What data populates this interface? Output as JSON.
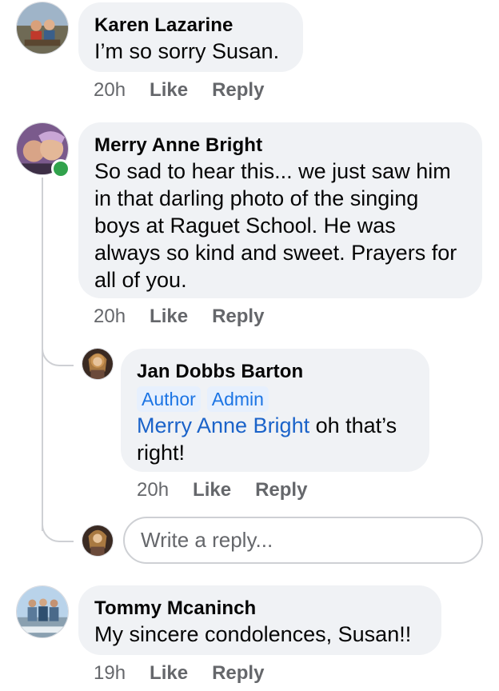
{
  "comments": [
    {
      "name": "Karen Lazarine",
      "text": "I’m so sorry Susan.",
      "time": "20h",
      "like": "Like",
      "reply": "Reply"
    },
    {
      "name": "Merry Anne Bright",
      "text": "So sad to hear this... we just saw him in that darling photo of the singing boys at Raguet School. He was always so kind and sweet.  Prayers for all of you.",
      "time": "20h",
      "like": "Like",
      "reply": "Reply",
      "online": true,
      "replies": [
        {
          "name": "Jan Dobbs Barton",
          "badges": [
            "Author",
            "Admin"
          ],
          "mention": "Merry Anne Bright",
          "text": " oh that’s right!",
          "time": "20h",
          "like": "Like",
          "reply": "Reply"
        }
      ],
      "reply_box": {
        "placeholder": "Write a reply..."
      }
    },
    {
      "name": "Tommy Mcaninch",
      "text": "My sincere condolences, Susan!!",
      "time": "19h",
      "like": "Like",
      "reply": "Reply"
    }
  ],
  "colors": {
    "bubble": "#f0f2f5",
    "meta_text": "#65676b",
    "badge_bg": "#e7f0fd",
    "badge_text": "#1b74e4",
    "mention": "#1b63c9",
    "online": "#31a24c"
  }
}
